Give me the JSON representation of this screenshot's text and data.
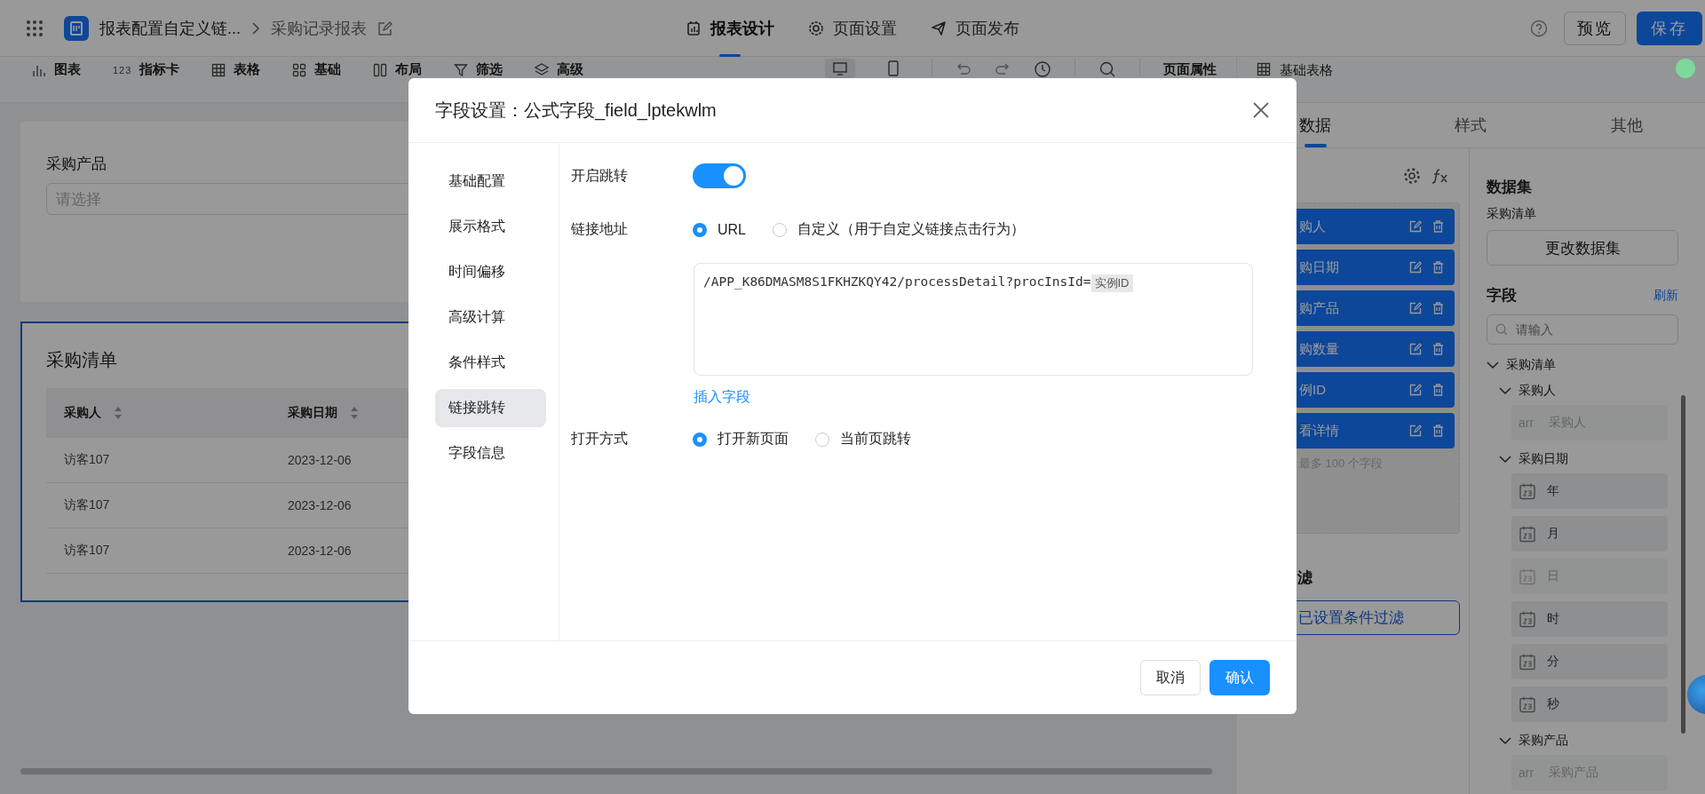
{
  "top_bar": {
    "app_title": "报表配置自定义链...",
    "page_title": "采购记录报表",
    "tabs": [
      {
        "label": "报表设计",
        "selected": true
      },
      {
        "label": "页面设置",
        "selected": false
      },
      {
        "label": "页面发布",
        "selected": false
      }
    ],
    "preview_button": "预览",
    "save_button": "保存"
  },
  "toolbar": {
    "items": [
      {
        "label": "图表"
      },
      {
        "label": "指标卡",
        "icon_text": "123"
      },
      {
        "label": "表格"
      },
      {
        "label": "基础"
      },
      {
        "label": "布局"
      },
      {
        "label": "筛选"
      },
      {
        "label": "高级"
      }
    ],
    "view_modes": [
      {
        "selected": true
      },
      {
        "selected": false
      }
    ],
    "page_properties": "页面属性",
    "component_title": "基础表格"
  },
  "canvas": {
    "filter_card": {
      "label": "采购产品",
      "placeholder": "请选择"
    },
    "table_card": {
      "title": "采购清单",
      "selected": true,
      "columns": [
        "采购人",
        "采购日期"
      ],
      "rows": [
        [
          "访客107",
          "2023-12-06"
        ],
        [
          "访客107",
          "2023-12-06"
        ],
        [
          "访客107",
          "2023-12-06"
        ]
      ]
    }
  },
  "properties_panel": {
    "tabs": [
      {
        "label": "数据",
        "selected": true
      },
      {
        "label": "样式",
        "selected": false
      },
      {
        "label": "其他",
        "selected": false
      }
    ],
    "field_list": [
      "购人",
      "购日期",
      "购产品",
      "购数量",
      "例ID",
      "看详情"
    ],
    "field_limit": "最多 100 个字段",
    "filter_heading": "滤",
    "filter_button": "已设置条件过滤",
    "dataset_heading": "数据集",
    "dataset_name": "采购清单",
    "change_dataset_button": "更改数据集",
    "fields_heading": "字段",
    "refresh_link": "刷新",
    "search_placeholder": "请输入",
    "tree": [
      {
        "label": "采购清单",
        "expanded": true,
        "children": [
          {
            "label": "采购人",
            "expanded": true,
            "children": [
              {
                "kind": "array",
                "type_tag": "arr",
                "label": "采购人",
                "disabled": true
              }
            ]
          },
          {
            "label": "采购日期",
            "expanded": true,
            "children": [
              {
                "kind": "date",
                "label": "年",
                "disabled": false
              },
              {
                "kind": "date",
                "label": "月",
                "disabled": false
              },
              {
                "kind": "date",
                "label": "日",
                "disabled": true
              },
              {
                "kind": "date",
                "label": "时",
                "disabled": false
              },
              {
                "kind": "date",
                "label": "分",
                "disabled": false
              },
              {
                "kind": "date",
                "label": "秒",
                "disabled": false
              }
            ]
          },
          {
            "label": "采购产品",
            "expanded": true,
            "children": [
              {
                "kind": "array",
                "type_tag": "arr",
                "label": "采购产品",
                "disabled": true
              }
            ]
          }
        ]
      }
    ]
  },
  "dialog": {
    "title": "字段设置：公式字段_field_lptekwlm",
    "nav": [
      {
        "label": "基础配置",
        "selected": false
      },
      {
        "label": "展示格式",
        "selected": false
      },
      {
        "label": "时间偏移",
        "selected": false
      },
      {
        "label": "高级计算",
        "selected": false
      },
      {
        "label": "条件样式",
        "selected": false
      },
      {
        "label": "链接跳转",
        "selected": true
      },
      {
        "label": "字段信息",
        "selected": false
      }
    ],
    "enable_jump": {
      "label": "开启跳转",
      "on": true
    },
    "link_address": {
      "label": "链接地址",
      "options": [
        {
          "label": "URL",
          "selected": true
        },
        {
          "label": "自定义（用于自定义链接点击行为）",
          "selected": false
        }
      ],
      "url_text": "/APP_K86DMASM8S1FKHZKQY42/processDetail?procInsId=",
      "url_field_tag": "实例ID",
      "insert_field_link": "插入字段"
    },
    "open_mode": {
      "label": "打开方式",
      "options": [
        {
          "label": "打开新页面",
          "selected": true
        },
        {
          "label": "当前页跳转",
          "selected": false
        }
      ]
    },
    "cancel_button": "取消",
    "confirm_button": "确认"
  }
}
